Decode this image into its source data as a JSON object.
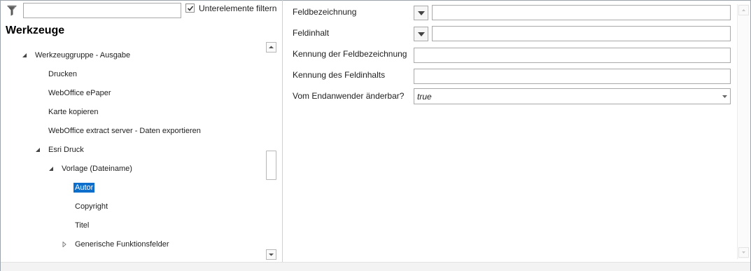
{
  "filter": {
    "input_value": "",
    "checkbox_label": "Unterelemente filtern",
    "checkbox_checked": true
  },
  "panel": {
    "title": "Werkzeuge"
  },
  "tree": [
    {
      "label": "Werkzeuggruppe - Ausgabe",
      "expander": "expanded",
      "selected": false
    },
    {
      "label": "Drucken",
      "expander": "none",
      "selected": false
    },
    {
      "label": "WebOffice ePaper",
      "expander": "none",
      "selected": false
    },
    {
      "label": "Karte kopieren",
      "expander": "none",
      "selected": false
    },
    {
      "label": "WebOffice extract server - Daten exportieren",
      "expander": "none",
      "selected": false
    },
    {
      "label": "Esri Druck",
      "expander": "expanded",
      "selected": false
    },
    {
      "label": "Vorlage (Dateiname)",
      "expander": "expanded",
      "selected": false
    },
    {
      "label": "Autor",
      "expander": "none",
      "selected": true
    },
    {
      "label": "Copyright",
      "expander": "none",
      "selected": false
    },
    {
      "label": "Titel",
      "expander": "none",
      "selected": false
    },
    {
      "label": "Generische Funktionsfelder",
      "expander": "collapsed",
      "selected": false
    }
  ],
  "form": {
    "feldbezeichnung_label": "Feldbezeichnung",
    "feldbezeichnung_value": "",
    "feldinhalt_label": "Feldinhalt",
    "feldinhalt_value": "",
    "kennung_feldbezeichnung_label": "Kennung der Feldbezeichnung",
    "kennung_feldbezeichnung_value": "",
    "kennung_feldinhalt_label": "Kennung des Feldinhalts",
    "kennung_feldinhalt_value": "",
    "aenderbar_label": "Vom Endanwender änderbar?",
    "aenderbar_value": "true"
  },
  "colors": {
    "selection": "#0d6ecb",
    "border": "#a9a9a9"
  },
  "icons": {
    "filter": "funnel-icon",
    "expanded": "triangle-down-right-icon",
    "collapsed": "triangle-right-outline-icon",
    "dropdown": "chevron-down-icon"
  }
}
